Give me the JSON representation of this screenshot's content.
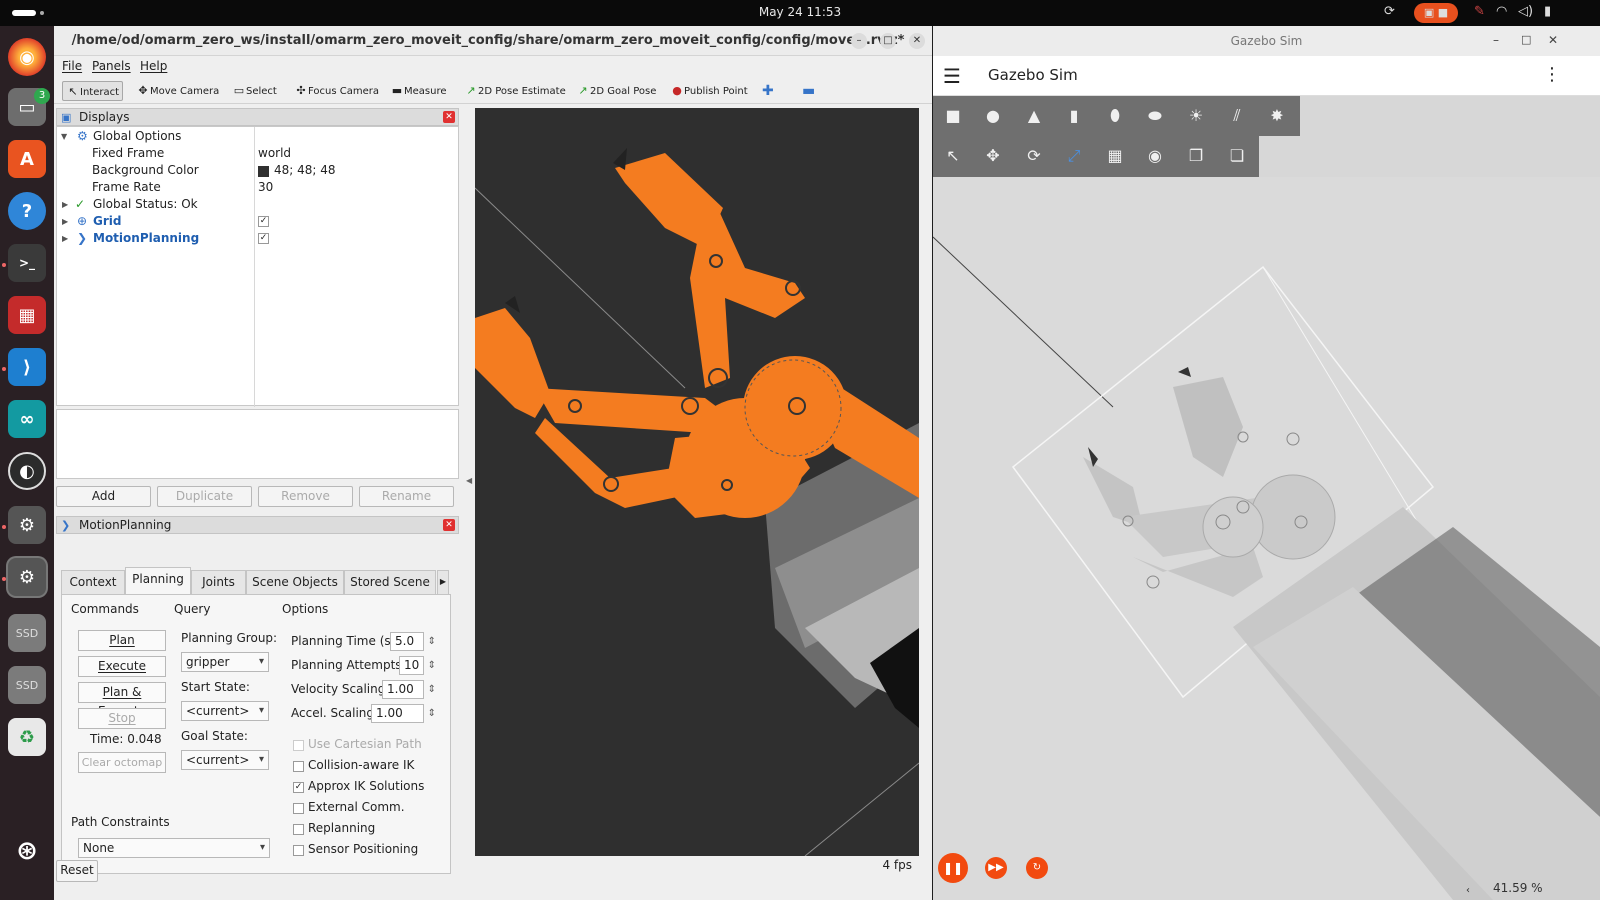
{
  "topbar": {
    "clock": "May 24  11:53"
  },
  "dock": {
    "files_badge": "3",
    "ssd_label_1": "SSD",
    "ssd_label_2": "SSD"
  },
  "rviz": {
    "title": "/home/od/omarm_zero_ws/install/omarm_zero_moveit_config/share/omarm_zero_moveit_config/config/moveit.rviz* - RViz",
    "menu": [
      "File",
      "Panels",
      "Help"
    ],
    "toolbar": [
      "Interact",
      "Move Camera",
      "Select",
      "Focus Camera",
      "Measure",
      "2D Pose Estimate",
      "2D Goal Pose",
      "Publish Point"
    ],
    "displays": {
      "header": "Displays",
      "global_options": "Global Options",
      "fixed_frame_label": "Fixed Frame",
      "fixed_frame_value": "world",
      "bg_color_label": "Background Color",
      "bg_color_value": "48; 48; 48",
      "frame_rate_label": "Frame Rate",
      "frame_rate_value": "30",
      "global_status": "Global Status: Ok",
      "grid": "Grid",
      "motion_planning": "MotionPlanning",
      "buttons": [
        "Add",
        "Duplicate",
        "Remove",
        "Rename"
      ]
    },
    "motion_panel": {
      "header": "MotionPlanning",
      "tabs": [
        "Context",
        "Planning",
        "Joints",
        "Scene Objects",
        "Stored Scene"
      ],
      "commands_label": "Commands",
      "query_label": "Query",
      "options_label": "Options",
      "plan": "Plan",
      "execute": "Execute",
      "plan_execute": "Plan & Execute",
      "stop": "Stop",
      "time": "Time: 0.048",
      "clear_octomap": "Clear octomap",
      "planning_group_label": "Planning Group:",
      "planning_group": "gripper",
      "start_state_label": "Start State:",
      "start_state": "<current>",
      "goal_state_label": "Goal State:",
      "goal_state": "<current>",
      "planning_time_label": "Planning Time (s):",
      "planning_time": "5.0",
      "planning_attempts_label": "Planning Attempts:",
      "planning_attempts": "10",
      "velocity_label": "Velocity Scaling:",
      "velocity": "1.00",
      "accel_label": "Accel. Scaling:",
      "accel": "1.00",
      "options": [
        {
          "label": "Use Cartesian Path",
          "checked": false,
          "disabled": true
        },
        {
          "label": "Collision-aware IK",
          "checked": false,
          "disabled": false
        },
        {
          "label": "Approx IK Solutions",
          "checked": true,
          "disabled": false
        },
        {
          "label": "External Comm.",
          "checked": false,
          "disabled": false
        },
        {
          "label": "Replanning",
          "checked": false,
          "disabled": false
        },
        {
          "label": "Sensor Positioning",
          "checked": false,
          "disabled": false
        }
      ],
      "path_constraints_label": "Path Constraints",
      "path_constraints": "None"
    },
    "reset": "Reset",
    "fps": "4 fps"
  },
  "gazebo": {
    "window_title": "Gazebo Sim",
    "app_title": "Gazebo Sim",
    "zoom": "41.59 %"
  },
  "colors": {
    "orange": "#f47c20",
    "bg3d": "#303030",
    "gz_button": "#f24a0f"
  }
}
